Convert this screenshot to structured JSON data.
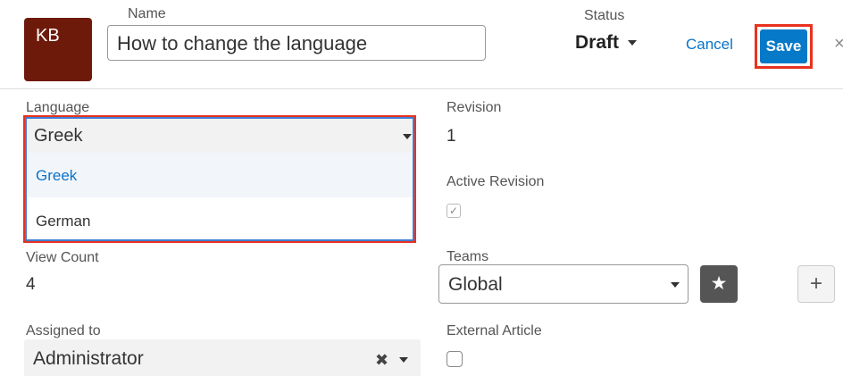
{
  "header": {
    "avatar_text": "KB",
    "name_label": "Name",
    "name_value": "How to change the language",
    "status_label": "Status",
    "status_value": "Draft",
    "cancel_label": "Cancel",
    "save_label": "Save",
    "close_icon": "×"
  },
  "language": {
    "label": "Language",
    "selected": "Greek",
    "options": [
      "Greek",
      "German"
    ]
  },
  "revision": {
    "label": "Revision",
    "value": "1"
  },
  "active_revision": {
    "label": "Active Revision",
    "checked": true,
    "check_glyph": "✓"
  },
  "view_count": {
    "label": "View Count",
    "value": "4"
  },
  "teams": {
    "label": "Teams",
    "value": "Global",
    "star_glyph": "★",
    "plus_glyph": "+"
  },
  "assigned_to": {
    "label": "Assigned to",
    "value": "Administrator",
    "clear_glyph": "✖"
  },
  "external_article": {
    "label": "External Article",
    "checked": false
  },
  "colors": {
    "accent": "#0679c8",
    "highlight": "#e8321f",
    "avatar": "#6e1a0a"
  }
}
